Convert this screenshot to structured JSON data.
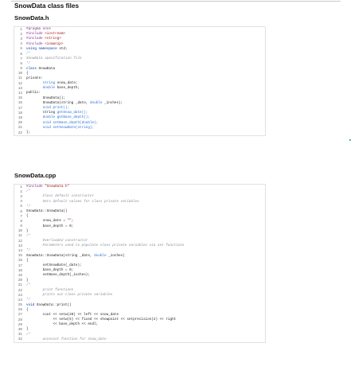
{
  "title": "SnowData class files",
  "header_section": {
    "filename": "SnowData.h",
    "lines": [
      {
        "n": "1",
        "segments": [
          {
            "cls": "c-pre",
            "t": "#pragma once"
          }
        ]
      },
      {
        "n": "2",
        "segments": [
          {
            "cls": "c-pre",
            "t": "#include "
          },
          {
            "cls": "c-str",
            "t": "<iostream>"
          }
        ]
      },
      {
        "n": "3",
        "segments": [
          {
            "cls": "c-pre",
            "t": "#include "
          },
          {
            "cls": "c-str",
            "t": "<string>"
          }
        ]
      },
      {
        "n": "4",
        "segments": [
          {
            "cls": "c-pre",
            "t": "#include "
          },
          {
            "cls": "c-str",
            "t": "<iomanip>"
          }
        ]
      },
      {
        "n": "5",
        "segments": [
          {
            "cls": "c-kw",
            "t": "using namespace "
          },
          {
            "cls": "",
            "t": "std;"
          }
        ]
      },
      {
        "n": "6",
        "segments": [
          {
            "cls": "c-com",
            "t": "/*"
          }
        ]
      },
      {
        "n": "7",
        "segments": [
          {
            "cls": "c-com",
            "t": "SnowData specification file"
          }
        ]
      },
      {
        "n": "8",
        "segments": [
          {
            "cls": "c-com",
            "t": "*/"
          }
        ]
      },
      {
        "n": "9",
        "segments": [
          {
            "cls": "c-kw",
            "t": "class "
          },
          {
            "cls": "",
            "t": "SnowData"
          }
        ]
      },
      {
        "n": "10",
        "segments": [
          {
            "cls": "",
            "t": "{"
          }
        ]
      },
      {
        "n": "11",
        "segments": [
          {
            "cls": "",
            "t": "private:"
          }
        ]
      },
      {
        "n": "12",
        "segments": [
          {
            "cls": "",
            "t": "        "
          },
          {
            "cls": "c-typ",
            "t": "string"
          },
          {
            "cls": "",
            "t": " snow_date;"
          }
        ]
      },
      {
        "n": "13",
        "segments": [
          {
            "cls": "",
            "t": "        "
          },
          {
            "cls": "c-typ",
            "t": "double"
          },
          {
            "cls": "",
            "t": " base_depth;"
          }
        ]
      },
      {
        "n": "14",
        "segments": [
          {
            "cls": "",
            "t": "public:"
          }
        ]
      },
      {
        "n": "15",
        "segments": [
          {
            "cls": "",
            "t": "        SnowData();"
          }
        ]
      },
      {
        "n": "16",
        "segments": [
          {
            "cls": "",
            "t": "        SnowData(string _date, "
          },
          {
            "cls": "c-typ",
            "t": "double"
          },
          {
            "cls": "",
            "t": " _inches);"
          }
        ]
      },
      {
        "n": "17",
        "segments": [
          {
            "cls": "",
            "t": "        "
          },
          {
            "cls": "c-typ",
            "t": "void print();"
          }
        ]
      },
      {
        "n": "18",
        "segments": [
          {
            "cls": "",
            "t": "        string "
          },
          {
            "cls": "c-typ",
            "t": "getSnow_date();"
          }
        ]
      },
      {
        "n": "19",
        "segments": [
          {
            "cls": "",
            "t": "        "
          },
          {
            "cls": "c-typ",
            "t": "double getBase_depth();"
          }
        ]
      },
      {
        "n": "20",
        "segments": [
          {
            "cls": "",
            "t": "        "
          },
          {
            "cls": "c-typ",
            "t": "void setBase_depth(double);"
          }
        ]
      },
      {
        "n": "21",
        "segments": [
          {
            "cls": "",
            "t": "        "
          },
          {
            "cls": "c-typ",
            "t": "void setSnowDate(string);"
          }
        ]
      },
      {
        "n": "22",
        "segments": [
          {
            "cls": "",
            "t": "};"
          }
        ]
      }
    ]
  },
  "cpp_section": {
    "filename": "SnowData.cpp",
    "lines": [
      {
        "n": "1",
        "segments": [
          {
            "cls": "c-pre",
            "t": "#include "
          },
          {
            "cls": "c-str",
            "t": "\"SnowData.h\""
          }
        ]
      },
      {
        "n": "2",
        "segments": [
          {
            "cls": "c-com",
            "t": "/*"
          }
        ]
      },
      {
        "n": "3",
        "segments": [
          {
            "cls": "c-com",
            "t": "        Class default constructor"
          }
        ]
      },
      {
        "n": "4",
        "segments": [
          {
            "cls": "c-com",
            "t": "        Sets default values for class private variables"
          }
        ]
      },
      {
        "n": "5",
        "segments": [
          {
            "cls": "c-com",
            "t": "*/"
          }
        ]
      },
      {
        "n": "6",
        "segments": [
          {
            "cls": "",
            "t": "SnowData::SnowData()"
          }
        ]
      },
      {
        "n": "7",
        "segments": [
          {
            "cls": "",
            "t": "{"
          }
        ]
      },
      {
        "n": "8",
        "segments": [
          {
            "cls": "",
            "t": "        snow_date = "
          },
          {
            "cls": "c-str",
            "t": "\"\""
          },
          {
            "cls": "",
            "t": ";"
          }
        ]
      },
      {
        "n": "9",
        "segments": [
          {
            "cls": "",
            "t": "        base_depth = 0;"
          }
        ]
      },
      {
        "n": "10",
        "segments": [
          {
            "cls": "",
            "t": "}"
          }
        ]
      },
      {
        "n": "11",
        "segments": [
          {
            "cls": "c-com",
            "t": "/*"
          }
        ]
      },
      {
        "n": "12",
        "segments": [
          {
            "cls": "c-com",
            "t": "        Overloaded constructor"
          }
        ]
      },
      {
        "n": "13",
        "segments": [
          {
            "cls": "c-com",
            "t": "        Parameters used to populate class private variables via set functions"
          }
        ]
      },
      {
        "n": "14",
        "segments": [
          {
            "cls": "c-com",
            "t": "*/"
          }
        ]
      },
      {
        "n": "15",
        "segments": [
          {
            "cls": "",
            "t": "SnowData::SnowData(string _date, "
          },
          {
            "cls": "c-typ",
            "t": "double"
          },
          {
            "cls": "",
            "t": " _inches)"
          }
        ]
      },
      {
        "n": "16",
        "segments": [
          {
            "cls": "",
            "t": "{"
          }
        ]
      },
      {
        "n": "17",
        "segments": [
          {
            "cls": "",
            "t": "        setSnowDate(_date);"
          }
        ]
      },
      {
        "n": "18",
        "segments": [
          {
            "cls": "",
            "t": "        base_depth = 0;"
          }
        ]
      },
      {
        "n": "19",
        "segments": [
          {
            "cls": "",
            "t": "        setBase_depth(_inches);"
          }
        ]
      },
      {
        "n": "20",
        "segments": [
          {
            "cls": "",
            "t": "}"
          }
        ]
      },
      {
        "n": "21",
        "segments": [
          {
            "cls": "c-com",
            "t": "/*"
          }
        ]
      },
      {
        "n": "22",
        "segments": [
          {
            "cls": "c-com",
            "t": "        print functions"
          }
        ]
      },
      {
        "n": "23",
        "segments": [
          {
            "cls": "c-com",
            "t": "        prints out class private variables"
          }
        ]
      },
      {
        "n": "24",
        "segments": [
          {
            "cls": "c-com",
            "t": "*/"
          }
        ]
      },
      {
        "n": "25",
        "segments": [
          {
            "cls": "c-kw",
            "t": "void"
          },
          {
            "cls": "",
            "t": " SnowData::print()"
          }
        ]
      },
      {
        "n": "26",
        "segments": [
          {
            "cls": "",
            "t": "{"
          }
        ]
      },
      {
        "n": "27",
        "segments": [
          {
            "cls": "",
            "t": "        cout << setw(20) << left << snow_date"
          }
        ]
      },
      {
        "n": "28",
        "segments": [
          {
            "cls": "",
            "t": "             << setw(5) << fixed << showpoint << setprecision(2) << right"
          }
        ]
      },
      {
        "n": "29",
        "segments": [
          {
            "cls": "",
            "t": "             << base_depth << endl;"
          }
        ]
      },
      {
        "n": "30",
        "segments": [
          {
            "cls": "",
            "t": "}"
          }
        ]
      },
      {
        "n": "31",
        "segments": [
          {
            "cls": "c-com",
            "t": "/*"
          }
        ]
      },
      {
        "n": "32",
        "segments": [
          {
            "cls": "c-com",
            "t": "        accessor function for snow_date"
          }
        ]
      }
    ]
  }
}
